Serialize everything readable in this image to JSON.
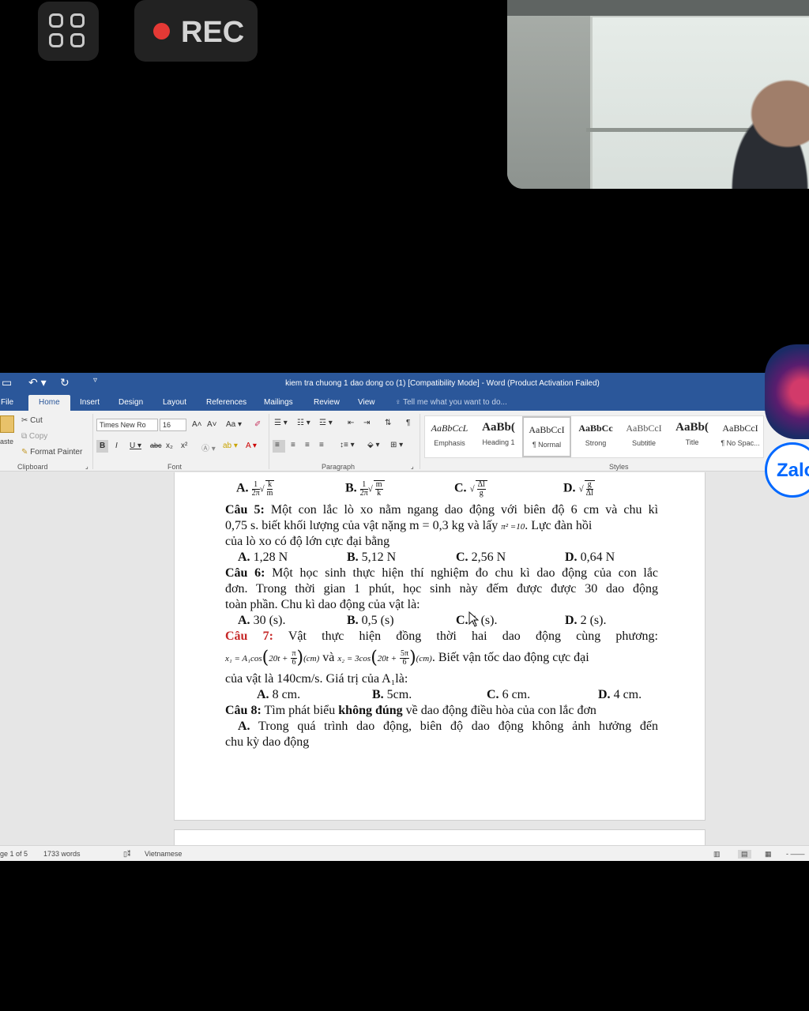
{
  "recorder": {
    "rec_label": "REC",
    "colors": {
      "dot": "#e53935",
      "panel": "#222222"
    }
  },
  "word": {
    "title": "kiem tra chuong 1 dao dong co (1) [Compatibility Mode] - Word (Product Activation Failed)",
    "tabs": [
      "File",
      "Home",
      "Insert",
      "Design",
      "Layout",
      "References",
      "Mailings",
      "Review",
      "View"
    ],
    "active_tab": "Home",
    "tellme": "Tell me what you want to do...",
    "clipboard": {
      "paste": "aste",
      "cut": "Cut",
      "copy": "Copy",
      "format_painter": "Format Painter",
      "label": "Clipboard"
    },
    "font": {
      "name": "Times New Ro",
      "size": "16",
      "label": "Font"
    },
    "paragraph_label": "Paragraph",
    "styles_label": "Styles",
    "styles": [
      {
        "sample": "AaBbCcL",
        "name": "Emphasis"
      },
      {
        "sample": "AaBb(",
        "name": "Heading 1"
      },
      {
        "sample": "AaBbCcI",
        "name": "¶ Normal"
      },
      {
        "sample": "AaBbCc",
        "name": "Strong"
      },
      {
        "sample": "AaBbCcI",
        "name": "Subtitle"
      },
      {
        "sample": "AaBb(",
        "name": "Title"
      },
      {
        "sample": "AaBbCcI",
        "name": "¶ No Spac..."
      }
    ],
    "accent": "#2b579a"
  },
  "document": {
    "q4_options": {
      "a": "A.",
      "b": "B.",
      "c": "C.",
      "d": "D."
    },
    "q5": {
      "label": "Câu 5:",
      "line1": "Một con lắc lò xo nằm ngang dao động với biên độ 6 cm và chu kì",
      "line2a": "0,75 s. biết khối lượng của vật nặng m = 0,3 kg và lấy",
      "pi_expr": "π² =10",
      "line2b": ". Lực đàn hồi",
      "line3": "của lò xo có độ lớn cực đại bằng",
      "options": [
        {
          "key": "A.",
          "text": "1,28 N"
        },
        {
          "key": "B.",
          "text": "5,12 N"
        },
        {
          "key": "C.",
          "text": "2,56 N"
        },
        {
          "key": "D.",
          "text": "0,64 N"
        }
      ]
    },
    "q6": {
      "label": "Câu 6:",
      "line1": "Một học sinh thực hiện thí nghiệm đo chu kì dao động của con lắc",
      "line2": "đơn. Trong thời gian 1 phút, học sinh này đếm được được 30 dao động",
      "line3": "toàn phần. Chu kì dao động của vật là:",
      "options": [
        {
          "key": "A.",
          "text": "30 (s)."
        },
        {
          "key": "B.",
          "text": "0,5 (s)"
        },
        {
          "key": "C.",
          "text": "1 (s)."
        },
        {
          "key": "D.",
          "text": "2 (s)."
        }
      ]
    },
    "q7": {
      "label": "Câu 7:",
      "line1": "Vật thực hiện đồng thời hai dao động cùng phương:",
      "x1": "x₁ = A₁cos",
      "x1_inner": "20t +",
      "pi": "π",
      "six": "6",
      "five_pi": "5π",
      "unit": "(cm)",
      "and": "và",
      "x2": "x₂ = 3cos",
      "x2_inner": "20t +",
      "line2_tail": ". Biết vận tốc dao động cực đại",
      "line3": "của vật là 140cm/s. Giá trị của A₁là:",
      "options": [
        {
          "key": "A.",
          "text": "8 cm."
        },
        {
          "key": "B.",
          "text": "5cm."
        },
        {
          "key": "C.",
          "text": "6 cm."
        },
        {
          "key": "D.",
          "text": "4 cm."
        }
      ]
    },
    "q8": {
      "label": "Câu 8:",
      "pre": "Tìm phát biểu",
      "bold": "không đúng",
      "post": "về dao động điều hòa của con lắc đơn",
      "a_key": "A.",
      "a_line1": "Trong quá trình dao động, biên độ dao động không ảnh hưởng đến",
      "a_line2": "chu kỳ dao động"
    }
  },
  "status": {
    "page": "ge 1 of 5",
    "words": "1733 words",
    "language": "Vietnamese"
  },
  "overlay": {
    "zalo_label": "Zalo",
    "zalo_color": "#0068ff"
  }
}
